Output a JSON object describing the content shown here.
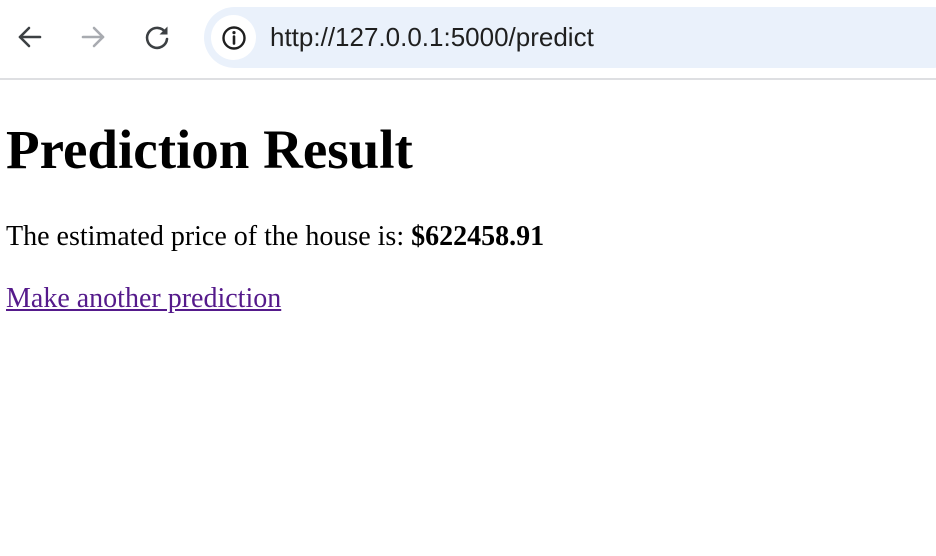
{
  "browser": {
    "url": "http://127.0.0.1:5000/predict",
    "icons": {
      "back": "arrow-left-icon",
      "forward": "arrow-right-icon",
      "reload": "reload-icon",
      "site_info": "info-circle-icon"
    },
    "colors": {
      "omnibox_bg": "#eaf1fb",
      "icon_active": "#3c4043",
      "icon_disabled": "#a8abb0"
    }
  },
  "page": {
    "title": "Prediction Result",
    "result_prefix": "The estimated price of the house is: ",
    "result_value": "$622458.91",
    "link_label": "Make another prediction",
    "colors": {
      "visited_link": "#551a8b"
    }
  }
}
